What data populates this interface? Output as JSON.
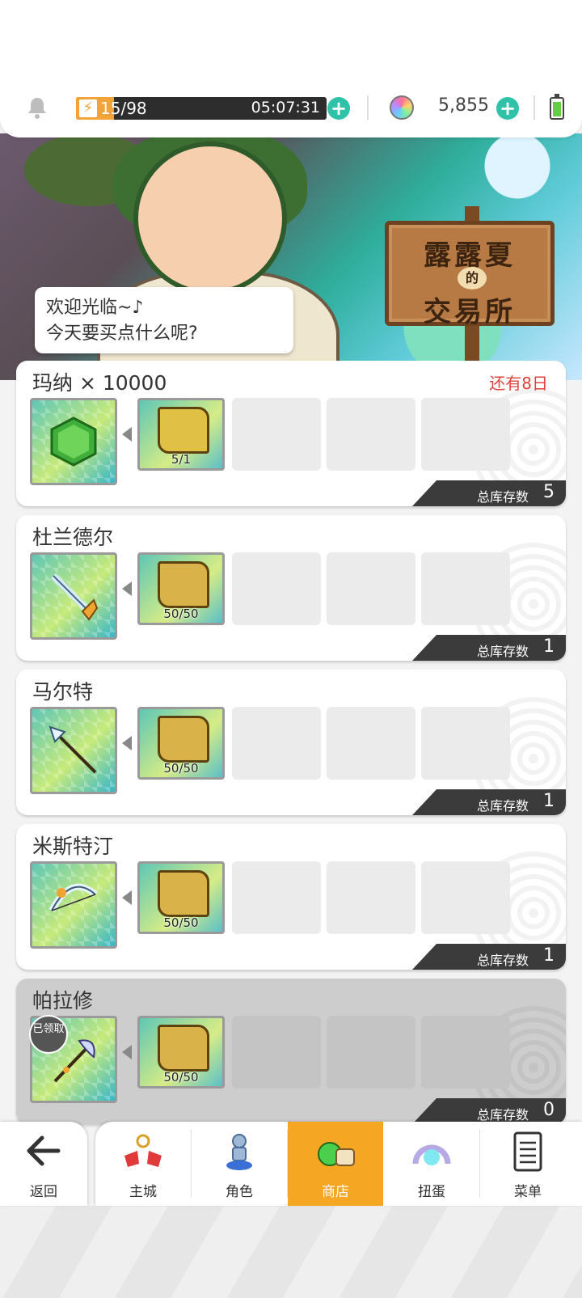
{
  "status_bar": {
    "energy": "15/98",
    "energy_fraction": 0.153,
    "timer": "05:07:31",
    "gems": "5,855"
  },
  "banner": {
    "sign_line1": "露露夏",
    "sign_de": "的",
    "sign_line2": "交易所",
    "greeting_line1": "欢迎光临~♪",
    "greeting_line2": "今天要买点什么呢?"
  },
  "shop": {
    "items": [
      {
        "title": "玛纳 × 10000",
        "deadline": "还有8日",
        "cost_qty": "5/1",
        "stock_label": "总库存数",
        "stock": "5",
        "claimed": false
      },
      {
        "title": "杜兰德尔",
        "deadline": "",
        "cost_qty": "50/50",
        "stock_label": "总库存数",
        "stock": "1",
        "claimed": false
      },
      {
        "title": "马尔特",
        "deadline": "",
        "cost_qty": "50/50",
        "stock_label": "总库存数",
        "stock": "1",
        "claimed": false
      },
      {
        "title": "米斯特汀",
        "deadline": "",
        "cost_qty": "50/50",
        "stock_label": "总库存数",
        "stock": "1",
        "claimed": false
      },
      {
        "title": "帕拉修",
        "deadline": "",
        "cost_qty": "50/50",
        "stock_label": "总库存数",
        "stock": "0",
        "claimed": true,
        "claimed_label": "已领取"
      }
    ]
  },
  "nav": {
    "back": "返回",
    "tabs": [
      {
        "label": "主城",
        "icon": "town-icon"
      },
      {
        "label": "角色",
        "icon": "character-icon"
      },
      {
        "label": "商店",
        "icon": "shop-icon",
        "active": true
      },
      {
        "label": "扭蛋",
        "icon": "gacha-icon"
      },
      {
        "label": "菜单",
        "icon": "menu-icon"
      }
    ]
  },
  "colors": {
    "accent_teal": "#2fc2a8",
    "active_tab": "#f5a623",
    "deadline_red": "#e0413c",
    "energy_orange": "#f2a33a"
  }
}
